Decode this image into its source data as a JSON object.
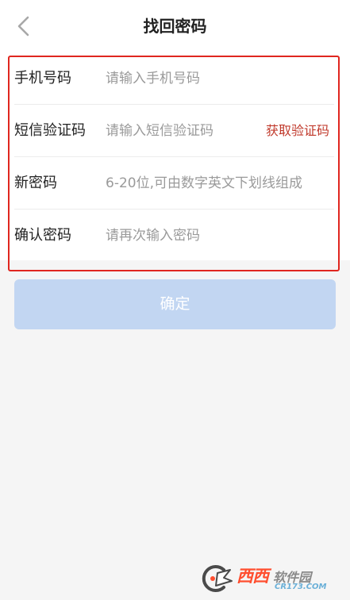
{
  "header": {
    "title": "找回密码",
    "back_icon": "chevron-left-icon"
  },
  "form": {
    "rows": [
      {
        "label": "手机号码",
        "placeholder": "请输入手机号码",
        "value": ""
      },
      {
        "label": "短信验证码",
        "placeholder": "请输入短信验证码",
        "value": "",
        "action": "获取验证码"
      },
      {
        "label": "新密码",
        "placeholder": "6-20位,可由数字英文下划线组成",
        "value": ""
      },
      {
        "label": "确认密码",
        "placeholder": "请再次输入密码",
        "value": ""
      }
    ]
  },
  "confirm_label": "确定",
  "watermark": {
    "brand": "西西",
    "site": "软件园",
    "url": "CR173.COM"
  },
  "colors": {
    "accent_red": "#c0392b",
    "highlight_border": "#e0261f",
    "button_disabled": "#c2d6f2",
    "background": "#f5f5f5"
  }
}
